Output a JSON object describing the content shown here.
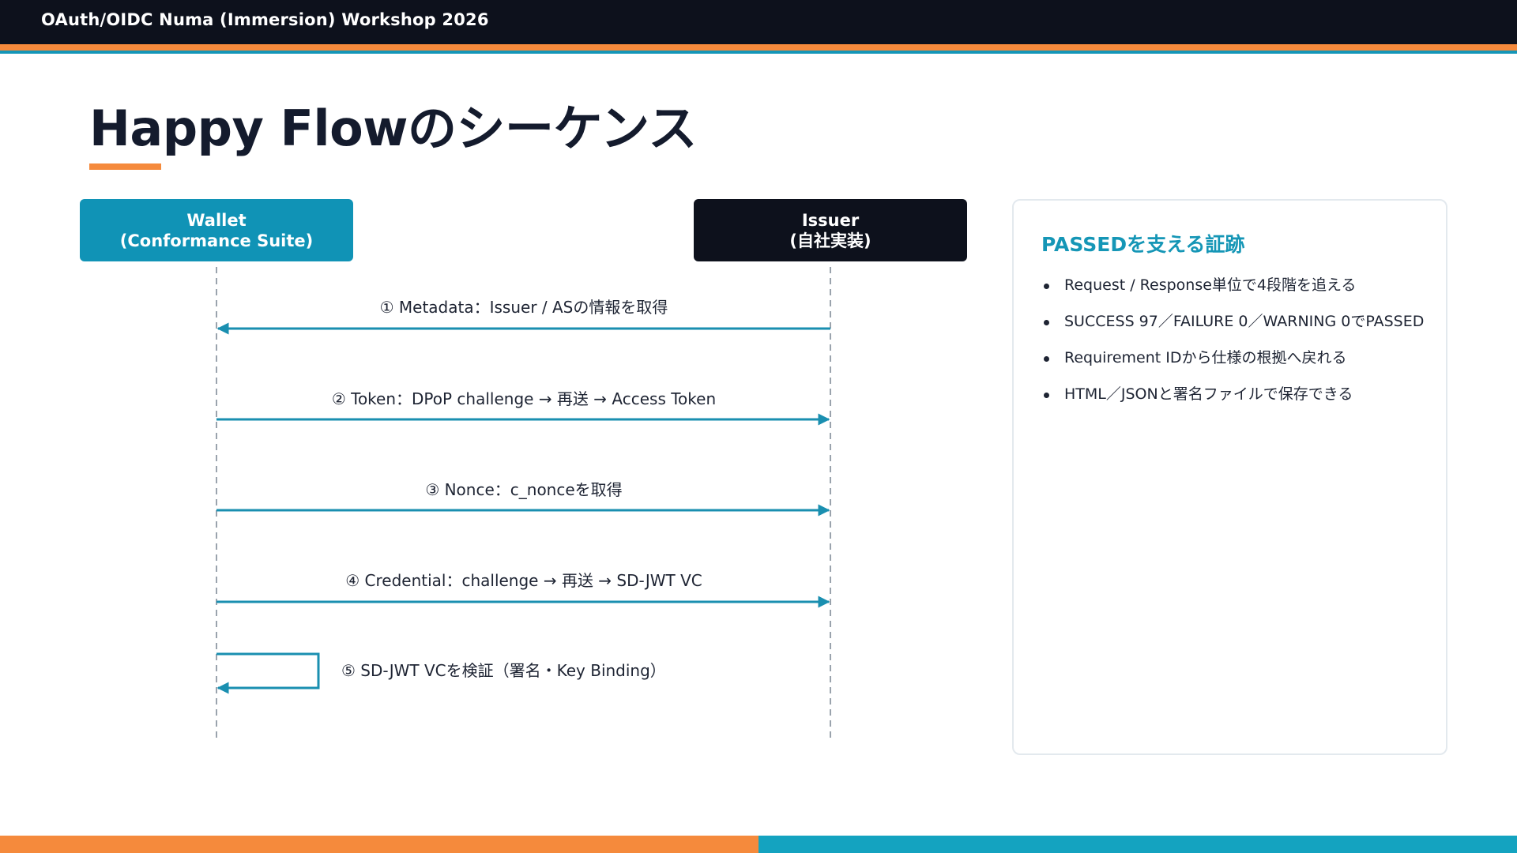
{
  "header": {
    "title": "OAuth/OIDC Numa (Immersion) Workshop 2026"
  },
  "slide": {
    "title": "Happy Flowのシーケンス"
  },
  "actors": {
    "wallet": {
      "line1": "Wallet",
      "line2": "(Conformance Suite)"
    },
    "issuer": {
      "line1": "Issuer",
      "line2": "(自社実装)"
    }
  },
  "messages": [
    {
      "label": "① Metadata：Issuer / ASの情報を取得",
      "direction": "issuer-to-wallet"
    },
    {
      "label": "② Token：DPoP challenge → 再送 → Access Token",
      "direction": "wallet-to-issuer"
    },
    {
      "label": "③ Nonce：c_nonceを取得",
      "direction": "wallet-to-issuer"
    },
    {
      "label": "④ Credential：challenge → 再送 → SD-JWT VC",
      "direction": "wallet-to-issuer"
    },
    {
      "label": "⑤ SD-JWT VCを検証（署名・Key Binding）",
      "direction": "self-wallet"
    }
  ],
  "panel": {
    "heading": "PASSEDを支える証跡",
    "items": [
      "Request / Response単位で4段階を追える",
      "SUCCESS 97／FAILURE 0／WARNING 0でPASSED",
      "Requirement IDから仕様の根拠へ戻れる",
      "HTML／JSONと署名ファイルで保存できる"
    ]
  },
  "colors": {
    "dark": "#0d111c",
    "accent_orange": "#f58a3c",
    "accent_blue": "#1496b8",
    "arrow": "#1a8fb0",
    "lifeline": "#9aa3ad"
  }
}
